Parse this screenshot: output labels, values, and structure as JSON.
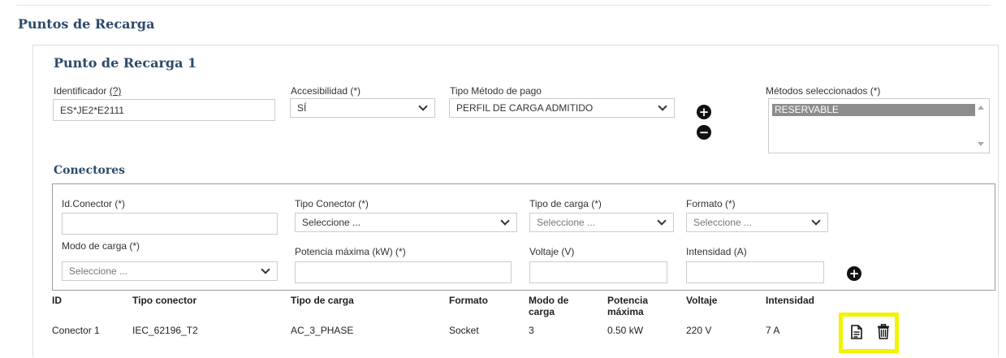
{
  "page_title": "Puntos de Recarga",
  "punto": {
    "title": "Punto de Recarga 1",
    "identificador_label": "Identificador",
    "identificador_help": "(?)",
    "identificador_value": "ES*JE2*E2111",
    "accesibilidad_label": "Accesibilidad (*)",
    "accesibilidad_value": "SÍ",
    "tipo_pago_label": "Tipo Método de pago",
    "tipo_pago_value": "PERFIL DE CARGA ADMITIDO",
    "metodos_label": "Métodos seleccionados (*)",
    "metodos_selected": [
      "RESERVABLE"
    ],
    "add_button": "+",
    "remove_button": "−"
  },
  "conectores": {
    "title": "Conectores",
    "form": {
      "id_label": "Id.Conector (*)",
      "id_value": "",
      "tipo_label": "Tipo Conector (*)",
      "tipo_value": "Seleccione ...",
      "tipo_carga_label": "Tipo de carga (*)",
      "tipo_carga_value": "Seleccione ...",
      "formato_label": "Formato (*)",
      "formato_value": "Seleccione ...",
      "modo_label": "Modo de carga (*)",
      "modo_value": "Seleccione ...",
      "potencia_label": "Potencia máxima (kW) (*)",
      "potencia_value": "",
      "voltaje_label": "Voltaje (V)",
      "voltaje_value": "",
      "intensidad_label": "Intensidad (A)",
      "intensidad_value": "",
      "add_button": "+"
    },
    "table": {
      "headers": [
        "ID",
        "Tipo conector",
        "Tipo de carga",
        "Formato",
        "Modo de\ncarga",
        "Potencia\nmáxima",
        "Voltaje",
        "Intensidad"
      ],
      "rows": [
        [
          "Conector 1",
          "IEC_62196_T2",
          "AC_3_PHASE",
          "Socket",
          "3",
          "0.50 kW",
          "220 V",
          "7 A"
        ]
      ]
    }
  },
  "icons": {
    "edit": "document-icon",
    "delete": "trash-icon"
  },
  "colors": {
    "title": "#2d4a6b",
    "highlight": "#f3f300",
    "selected_option": "#8c8c8c"
  }
}
